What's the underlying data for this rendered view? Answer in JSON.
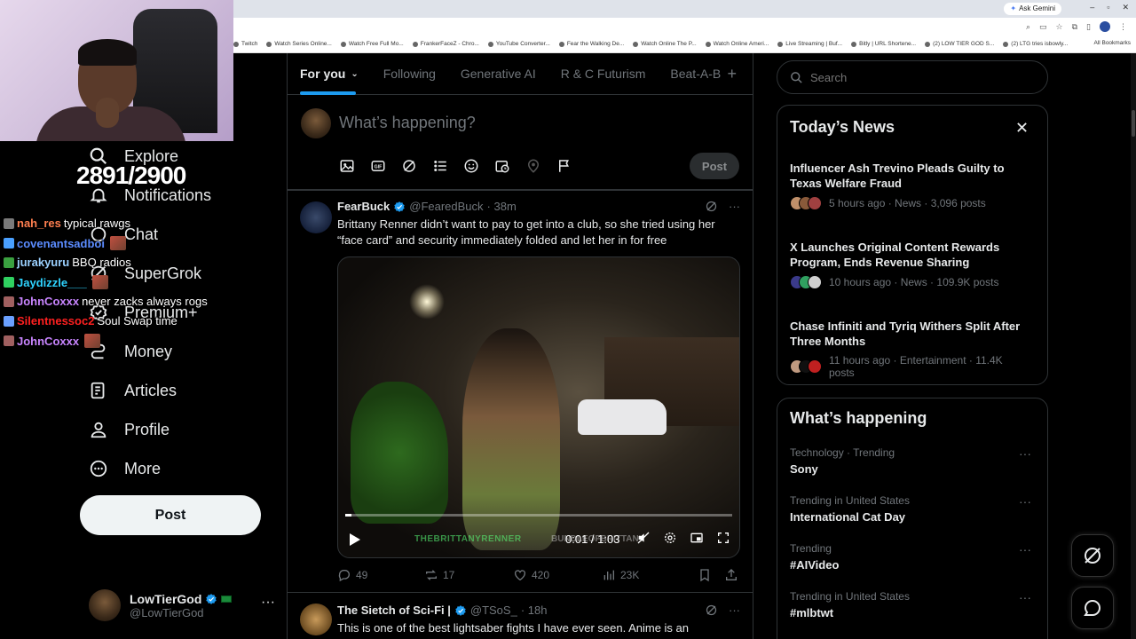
{
  "browser": {
    "ask_gemini": "Ask Gemini",
    "bookmarks": [
      "Twitch",
      "Watch Series Online...",
      "Watch Free Full Mo...",
      "FrankerFaceZ - Chro...",
      "YouTube Converter...",
      "Fear the Walking De...",
      "Watch Online The P...",
      "Watch Online Ameri...",
      "Live Streaming | Buf...",
      "Bitly | URL Shortene...",
      "(2) LOW TIER GOD S...",
      "(2) LTG tries isbowly..."
    ],
    "all_bookmarks": "All Bookmarks"
  },
  "overlay": {
    "counter": "2891/2900"
  },
  "chat": [
    {
      "user": "nah_res",
      "msg": "typical rawgs",
      "color": "#ff7f50"
    },
    {
      "user": "covenantsadboi",
      "msg": "",
      "color": "#5b8cff"
    },
    {
      "user": "jurakyuru",
      "msg": "BBQ radios",
      "color": "#9bd1ff"
    },
    {
      "user": "Jaydizzle___",
      "msg": "",
      "color": "#2ed3ff"
    },
    {
      "user": "JohnCoxxx",
      "msg": "never zacks always rogs",
      "color": "#c985ff"
    },
    {
      "user": "Silentnessoc2",
      "msg": "Soul Swap time",
      "color": "#ff2020"
    },
    {
      "user": "JohnCoxxx",
      "msg": "",
      "color": "#c985ff"
    }
  ],
  "nav": {
    "items": [
      {
        "label": "Explore",
        "icon": "search-icon"
      },
      {
        "label": "Notifications",
        "icon": "bell-icon"
      },
      {
        "label": "Chat",
        "icon": "chat-icon"
      },
      {
        "label": "SuperGrok",
        "icon": "grok-icon"
      },
      {
        "label": "Premium+",
        "icon": "premium-icon"
      },
      {
        "label": "Money",
        "icon": "money-icon"
      },
      {
        "label": "Articles",
        "icon": "articles-icon"
      },
      {
        "label": "Profile",
        "icon": "profile-icon"
      },
      {
        "label": "More",
        "icon": "more-icon"
      }
    ],
    "post_label": "Post"
  },
  "account": {
    "name": "LowTierGod",
    "handle": "@LowTierGod",
    "more": "···"
  },
  "feed": {
    "tabs": [
      "For you",
      "Following",
      "Generative AI",
      "R & C Futurism",
      "Beat-A-B"
    ],
    "active_tab": "For you",
    "compose_placeholder": "What’s happening?",
    "compose_post": "Post",
    "tweets": [
      {
        "name": "FearBuck",
        "handle": "@FearedBuck",
        "time": "· 38m",
        "text": "Brittany Renner didn’t want to pay to get into a club, so she tried using her “face card” and security immediately folded and let her in for free",
        "video": {
          "time": "0:01 / 1:03",
          "watermark": "THEBRITTANYRENNER",
          "watermark2": "BUNDLEOFBRITTANY",
          "progress": 0.016
        },
        "replies": "49",
        "reposts": "17",
        "likes": "420",
        "views": "23K"
      },
      {
        "name": "The Sietch of Sci-Fi |",
        "handle": "@TSoS_",
        "time": "· 18h",
        "text": "This is one of the best lightsaber fights I have ever seen. Anime is an"
      }
    ]
  },
  "search": {
    "placeholder": "Search"
  },
  "news": {
    "title": "Today’s News",
    "items": [
      {
        "title": "Influencer Ash Trevino Pleads Guilty to Texas Welfare Fraud",
        "meta": "5 hours ago · News · 3,096 posts"
      },
      {
        "title": "X Launches Original Content Rewards Program, Ends Revenue Sharing",
        "meta": "10 hours ago · News · 109.9K posts"
      },
      {
        "title": "Chase Infiniti and Tyriq Withers Split After Three Months",
        "meta": "11 hours ago · Entertainment · 11.4K posts"
      }
    ]
  },
  "happening": {
    "title": "What’s happening",
    "trends": [
      {
        "category": "Technology · Trending",
        "name": "Sony"
      },
      {
        "category": "Trending in United States",
        "name": "International Cat Day"
      },
      {
        "category": "Trending",
        "name": "#AIVideo"
      },
      {
        "category": "Trending in United States",
        "name": "#mlbtwt"
      }
    ]
  },
  "colors": {
    "accent": "#1d9bf0",
    "background": "#000000",
    "border": "#2f3336",
    "muted": "#71767b"
  }
}
